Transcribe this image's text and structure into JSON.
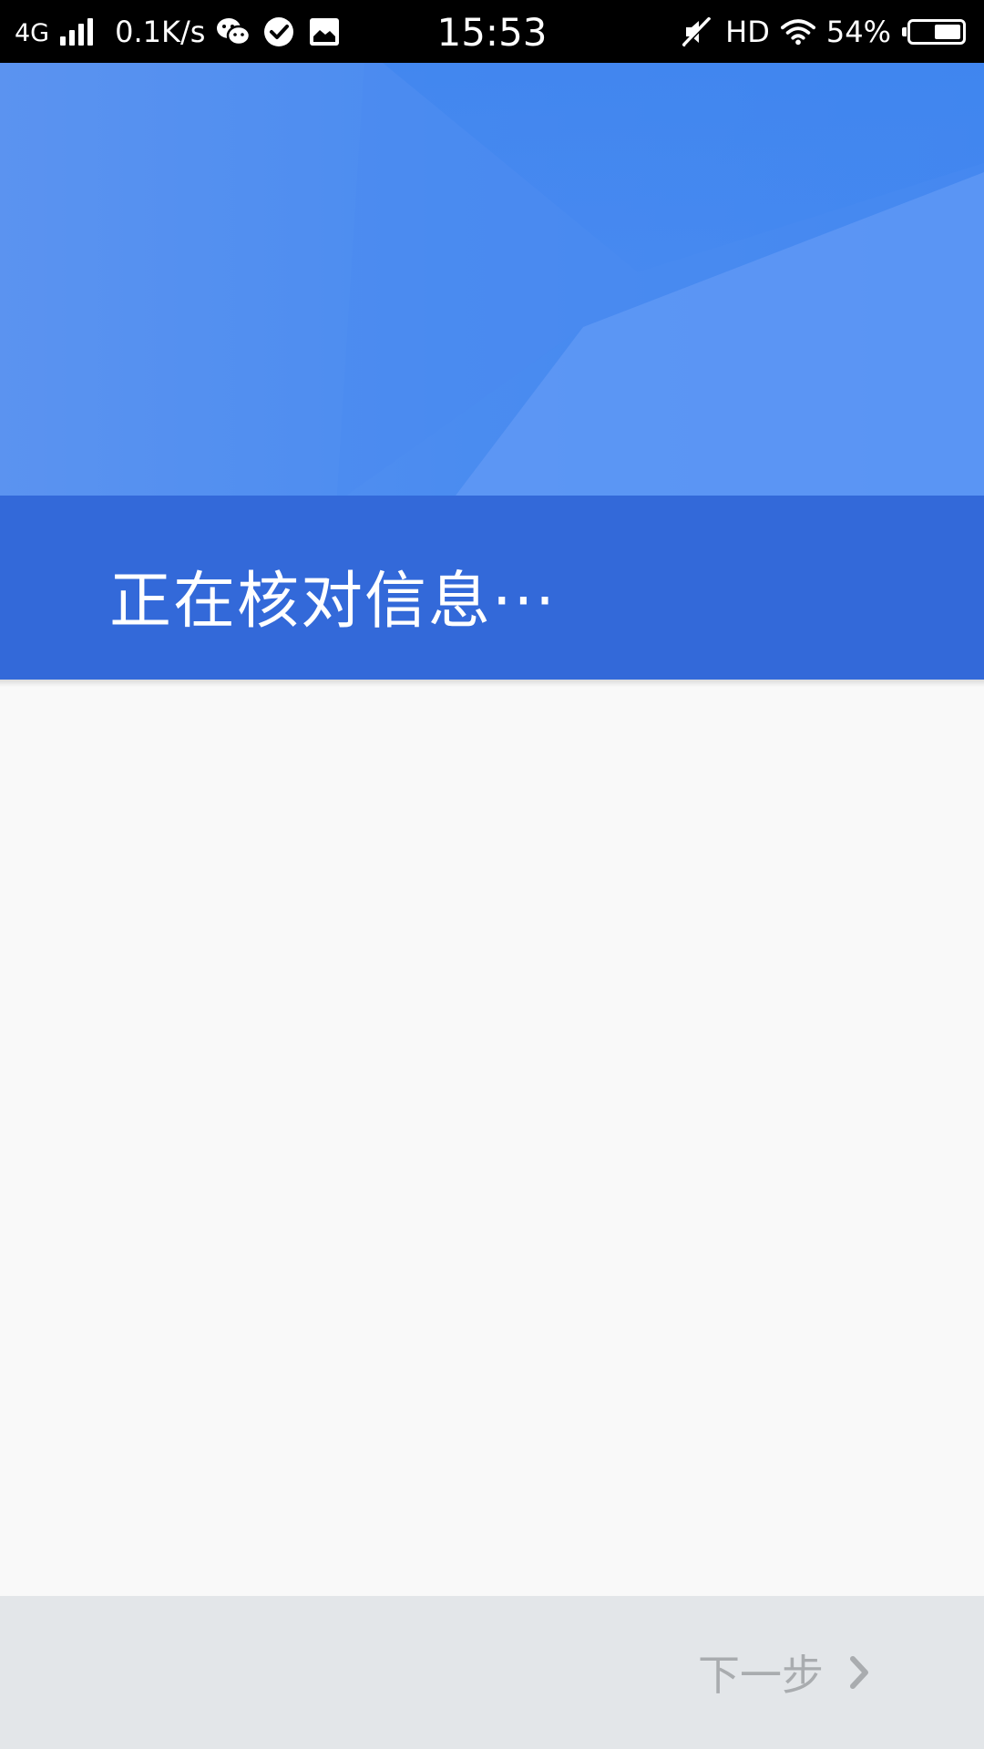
{
  "status_bar": {
    "network": "4G",
    "speed": "0.1K/s",
    "time": "15:53",
    "hd": "HD",
    "battery_percent": "54%",
    "battery_level": 0.54,
    "icons": [
      "signal-icon",
      "wechat-icon",
      "check-circle-icon",
      "image-icon",
      "mute-icon",
      "wifi-icon",
      "battery-icon"
    ]
  },
  "header": {
    "title": "正在核对信息···",
    "colors": {
      "art_light": "#5b93f0",
      "art_mid": "#4c8bf0",
      "art_dark": "#3f85ef",
      "band": "#3369d9"
    }
  },
  "footer": {
    "next_label": "下一步",
    "next_icon": "chevron-right-icon"
  },
  "colors": {
    "background": "#f9f9f9",
    "footer_bg": "#e3e6e9",
    "footer_text": "#a9acaf"
  }
}
